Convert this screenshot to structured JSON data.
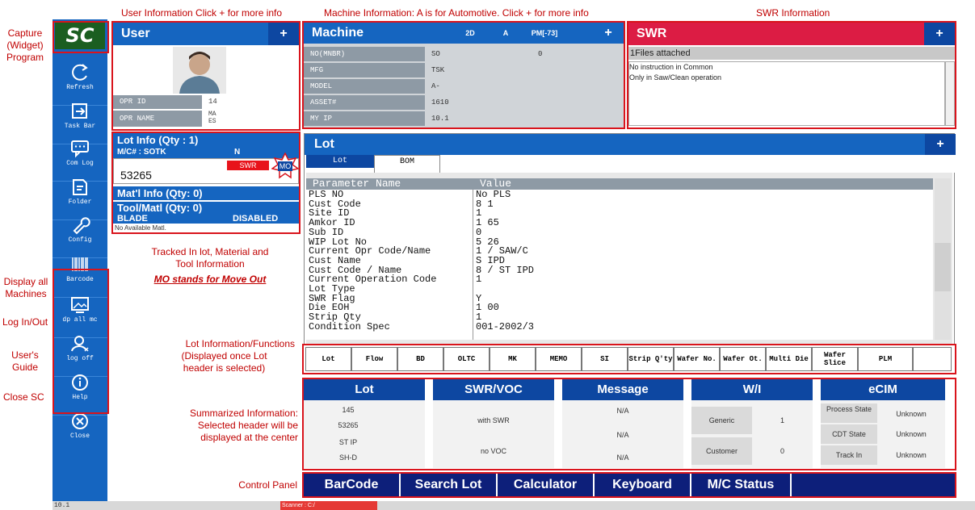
{
  "annotations": {
    "top_user": "User Information Click + for more info",
    "top_machine": "Machine Information: A is for Automotive. Click + for more info",
    "top_swr": "SWR Information",
    "capture": [
      "Capture",
      "(Widget)",
      "Program"
    ],
    "display_all": [
      "Display all",
      "Machines"
    ],
    "log_inout": "Log In/Out",
    "users_guide": [
      "User's",
      "Guide"
    ],
    "close_sc": "Close SC",
    "tracked": [
      "Tracked In lot, Material and",
      "Tool Information"
    ],
    "mo_note": "MO stands for Move Out",
    "lot_info_fn": [
      "Lot Information/Functions",
      "(Displayed once Lot",
      "header is selected)"
    ],
    "summarized": [
      "Summarized Information:",
      "Selected header will be",
      "displayed at the center"
    ],
    "control_panel": "Control Panel"
  },
  "sidebar": {
    "logo": "SC",
    "items": [
      {
        "label": "Refresh",
        "icon": "refresh-icon"
      },
      {
        "label": "Task Bar",
        "icon": "taskbar-icon"
      },
      {
        "label": "Com Log",
        "icon": "chat-icon"
      },
      {
        "label": "Folder",
        "icon": "folder-icon"
      },
      {
        "label": "Config",
        "icon": "wrench-icon"
      },
      {
        "label": "Barcode",
        "icon": "barcode-icon"
      },
      {
        "label": "dp all mc",
        "icon": "display-icon"
      },
      {
        "label": "log off",
        "icon": "user-icon"
      },
      {
        "label": "Help",
        "icon": "info-icon"
      },
      {
        "label": "Close",
        "icon": "close-icon"
      }
    ]
  },
  "user": {
    "title": "User",
    "plus": "+",
    "opr_id_label": "OPR ID",
    "opr_id_value": "14",
    "opr_name_label": "OPR NAME",
    "opr_name_value": "MA\nES"
  },
  "lotinfo": {
    "title": "Lot Info (Qty : 1)",
    "mc": "M/C# : SOTK",
    "mc_tail": "N",
    "lot": "53265",
    "swr": "SWR",
    "mo": "MO",
    "matl_title": "Mat'l Info (Qty:  0)",
    "tool_title": "Tool/Matl  (Qty: 0)",
    "blade": "BLADE",
    "disabled": "DISABLED",
    "no_matl": "No Available Matl."
  },
  "machine": {
    "title": "Machine",
    "btn_2d": "2D",
    "btn_a": "A",
    "btn_pm": "PM[-73]",
    "plus": "+",
    "rows": [
      {
        "label": "NO(MNBR)",
        "value": "SO",
        "tail": "0"
      },
      {
        "label": "MFG",
        "value": "TSK",
        "tail": ""
      },
      {
        "label": "MODEL",
        "value": "A-",
        "tail": ""
      },
      {
        "label": "ASSET#",
        "value": "1610",
        "tail": ""
      },
      {
        "label": "MY IP",
        "value": "10.1",
        "tail": ""
      }
    ]
  },
  "swr": {
    "title": "SWR",
    "plus": "+",
    "files": "1Files attached",
    "line1": "No instruction in Common",
    "line2": "Only in Saw/Clean operation"
  },
  "lot": {
    "title": "Lot",
    "plus": "+",
    "tabs": [
      "Lot",
      "BOM"
    ],
    "col_param": "Parameter Name",
    "col_value": "Value",
    "rows": [
      {
        "name": "PLS NO",
        "value": "No PLS"
      },
      {
        "name": "Cust Code",
        "value": "8  1"
      },
      {
        "name": "Site ID",
        "value": "1"
      },
      {
        "name": "Amkor ID",
        "value": "1 65"
      },
      {
        "name": "Sub ID",
        "value": "0"
      },
      {
        "name": "WIP Lot No",
        "value": "5 26"
      },
      {
        "name": "Current Opr Code/Name",
        "value": "1  / SAW/C"
      },
      {
        "name": "Cust Name",
        "value": "S  IPD"
      },
      {
        "name": "Cust Code / Name",
        "value": "8  / ST IPD"
      },
      {
        "name": "Current Operation Code",
        "value": "1"
      },
      {
        "name": "Lot Type",
        "value": ""
      },
      {
        "name": "SWR Flag",
        "value": "Y"
      },
      {
        "name": "Die EOH",
        "value": "1  00"
      },
      {
        "name": "Strip Qty",
        "value": "1"
      },
      {
        "name": "Condition Spec",
        "value": "001-2002/3"
      }
    ],
    "functions": [
      "Lot",
      "Flow",
      "BD",
      "OLTC",
      "MK",
      "MEMO",
      "SI",
      "Strip Q'ty",
      "Wafer No.",
      "Wafer Ot.",
      "Multi Die",
      "Wafer Slice",
      "PLM"
    ]
  },
  "summary": {
    "lot_hdr": "Lot",
    "lot_vals": [
      "145",
      "53265",
      "ST IP",
      "SH-D"
    ],
    "swr_hdr": "SWR/VOC",
    "swr_vals": [
      "with SWR",
      "no VOC"
    ],
    "msg_hdr": "Message",
    "msg_vals": [
      "N/A",
      "N/A",
      "N/A"
    ],
    "wi_hdr": "W/I",
    "wi_generic": "Generic",
    "wi_generic_val": "1",
    "wi_customer": "Customer",
    "wi_customer_val": "0",
    "ecim_hdr": "eCIM",
    "ecim_rows": [
      {
        "label": "Process State",
        "value": "Unknown"
      },
      {
        "label": "CDT State",
        "value": "Unknown"
      },
      {
        "label": "Track In",
        "value": "Unknown"
      }
    ]
  },
  "control_panel": {
    "buttons": [
      "BarCode",
      "Search Lot",
      "Calculator",
      "Keyboard",
      "M/C Status"
    ]
  },
  "statusbar": {
    "ip": "10.1",
    "scanner": "Scanner : C:/"
  },
  "colors": {
    "primary_blue": "#1565c0",
    "dark_blue": "#0d47a1",
    "swr_red": "#dc1c44",
    "annotation_red": "#c00000",
    "logo_green": "#1b5e20"
  }
}
